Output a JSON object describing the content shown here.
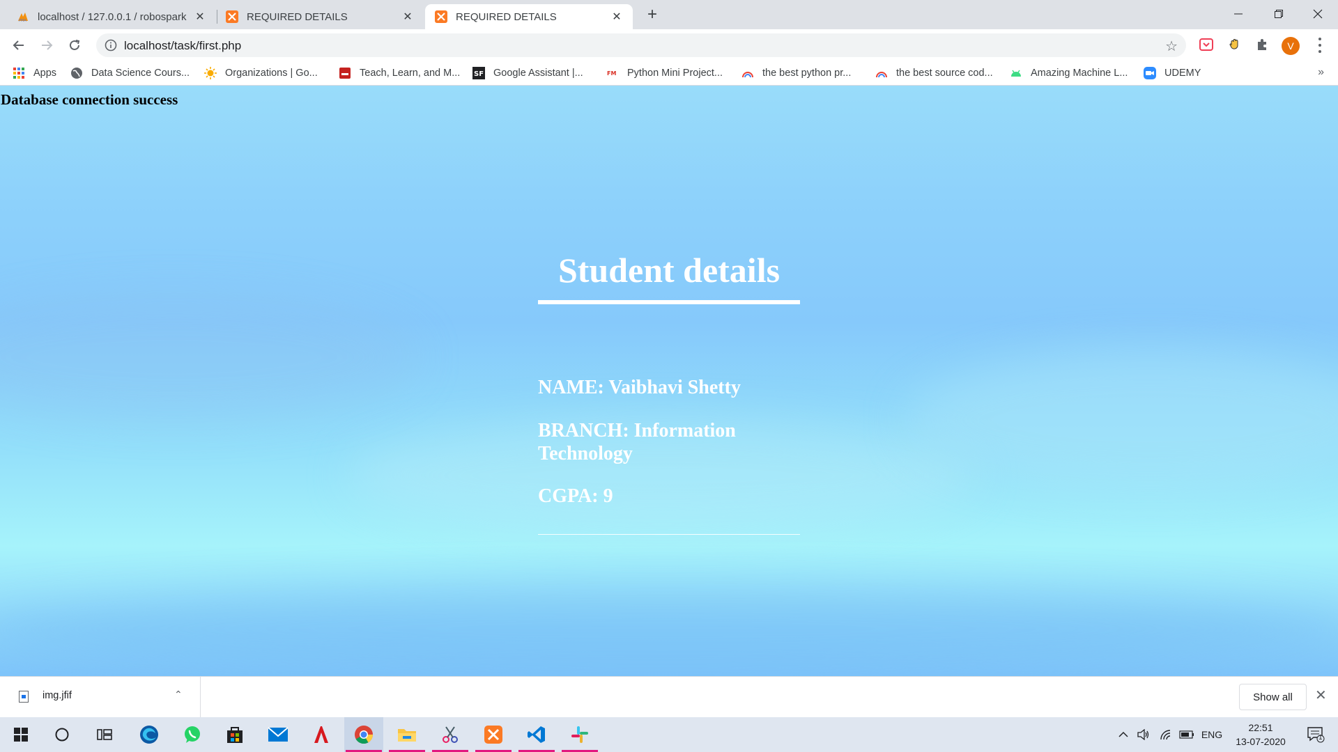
{
  "browser": {
    "tabs": [
      {
        "title": "localhost / 127.0.0.1 / robospark",
        "favicon": "phpmyadmin-icon",
        "active": false
      },
      {
        "title": "REQUIRED DETAILS",
        "favicon": "xampp-icon",
        "active": false
      },
      {
        "title": "REQUIRED DETAILS",
        "favicon": "xampp-icon",
        "active": true
      }
    ],
    "new_tab_symbol": "+",
    "url": "localhost/task/first.php",
    "profile_initial": "V",
    "bookmarks": [
      {
        "label": "Apps",
        "icon": "apps-grid-icon"
      },
      {
        "label": "Data Science Cours...",
        "icon": "globe-icon"
      },
      {
        "label": "Organizations | Go...",
        "icon": "sun-icon"
      },
      {
        "label": "Teach, Learn, and M...",
        "icon": "red-book-icon"
      },
      {
        "label": "Google Assistant |...",
        "icon": "sf-icon"
      },
      {
        "label": "Python Mini Project...",
        "icon": "fm-icon"
      },
      {
        "label": "the best python pr...",
        "icon": "rainbow-icon"
      },
      {
        "label": "the best source cod...",
        "icon": "rainbow-icon"
      },
      {
        "label": "Amazing Machine L...",
        "icon": "android-icon"
      },
      {
        "label": "UDEMY",
        "icon": "zoom-icon"
      }
    ]
  },
  "page": {
    "db_message": "Database connection success",
    "heading": "Student details",
    "name_line": "NAME: Vaibhavi Shetty",
    "branch_line": "BRANCH: Information Technology",
    "cgpa_line": "CGPA: 9"
  },
  "downloads": {
    "file_name": "img.jfif",
    "show_all_label": "Show all"
  },
  "taskbar": {
    "language": "ENG",
    "time": "22:51",
    "date": "13-07-2020",
    "notification_count": "1"
  },
  "colors": {
    "page_sky_top": "#99dcfa",
    "page_sky_bottom": "#a6f3fb",
    "profile_orange": "#e8710a",
    "running_underline": "#e2187f"
  }
}
